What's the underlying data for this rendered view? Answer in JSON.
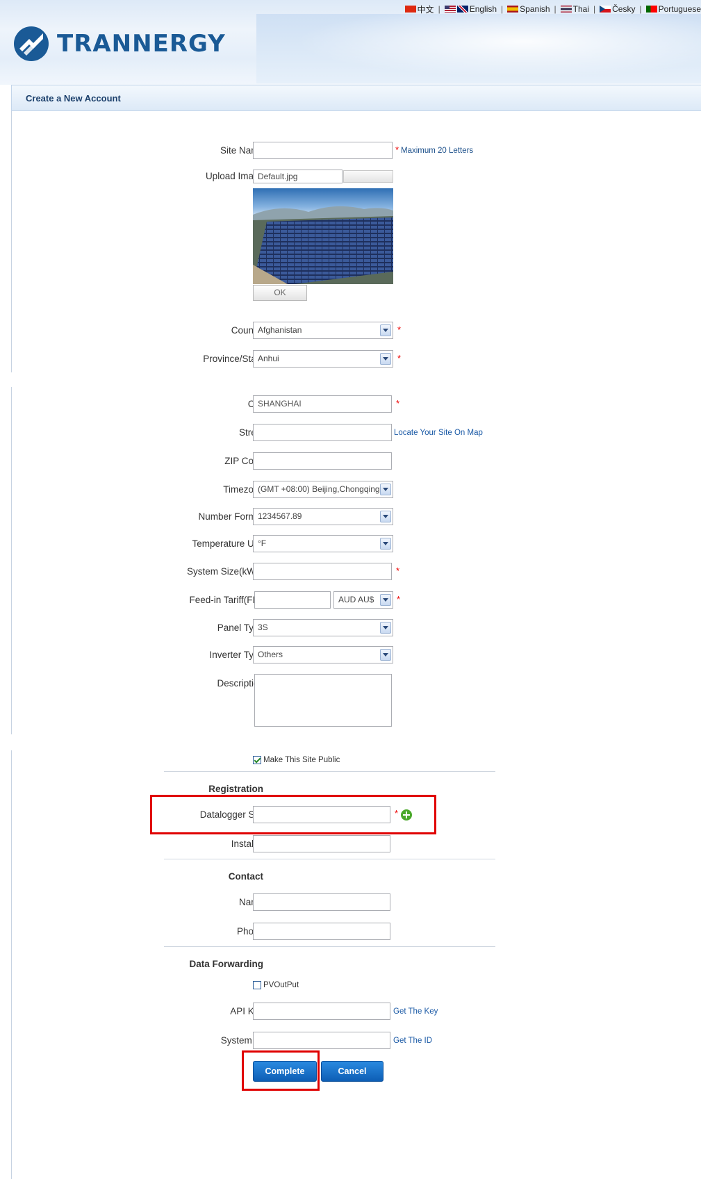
{
  "languages": [
    {
      "flag": "cn",
      "label": "中文"
    },
    {
      "flag": "us-uk",
      "label": "English"
    },
    {
      "flag": "es",
      "label": "Spanish"
    },
    {
      "flag": "th",
      "label": "Thai"
    },
    {
      "flag": "cz",
      "label": "Česky"
    },
    {
      "flag": "pt",
      "label": "Portuguese"
    }
  ],
  "brand": {
    "name": "TRANNERGY",
    "color": "#1a5a96"
  },
  "page": {
    "title": "Create a New Account"
  },
  "form": {
    "site_name": {
      "label": "Site Name",
      "value": "",
      "hint": "Maximum 20 Letters"
    },
    "upload_image": {
      "label": "Upload Image",
      "value": "Default.jpg",
      "ok_label": "OK"
    },
    "country": {
      "label": "Country",
      "value": "Afghanistan"
    },
    "province": {
      "label": "Province/State",
      "value": "Anhui"
    },
    "city": {
      "label": "City",
      "value": "SHANGHAI"
    },
    "street": {
      "label": "Street",
      "value": "",
      "link": "Locate Your Site On Map"
    },
    "zip": {
      "label": "ZIP Code",
      "value": ""
    },
    "timezone": {
      "label": "Timezone",
      "value": "(GMT +08:00) Beijing,Chongqing"
    },
    "number_format": {
      "label": "Number Format",
      "value": "1234567.89"
    },
    "temperature_unit": {
      "label": "Temperature Unit",
      "value": "°F"
    },
    "system_size": {
      "label": "System Size(kWp)",
      "value": ""
    },
    "fit": {
      "label": "Feed-in Tariff(FIT)",
      "value": "",
      "currency": "AUD AU$"
    },
    "panel_type": {
      "label": "Panel Type",
      "value": "3S"
    },
    "inverter_type": {
      "label": "Inverter Type",
      "value": "Others"
    },
    "description": {
      "label": "Description",
      "value": ""
    },
    "public": {
      "label": "Make This Site Public",
      "checked": true
    }
  },
  "registration": {
    "heading": "Registration",
    "datalogger": {
      "label": "Datalogger S/N",
      "value": ""
    },
    "installer": {
      "label": "Installer",
      "value": ""
    }
  },
  "contact": {
    "heading": "Contact",
    "name": {
      "label": "Name",
      "value": ""
    },
    "phone": {
      "label": "Phone",
      "value": ""
    }
  },
  "forwarding": {
    "heading": "Data Forwarding",
    "pvoutput": {
      "label": "PVOutPut",
      "checked": false
    },
    "api_key": {
      "label": "API Key",
      "value": "",
      "link": "Get The Key"
    },
    "system_id": {
      "label": "System ID",
      "value": "",
      "link": "Get The ID"
    }
  },
  "actions": {
    "complete": "Complete",
    "cancel": "Cancel"
  },
  "colors": {
    "accent": "#1b5aa6",
    "required": "#e00000",
    "highlight": "#e00000",
    "button": "#1565c0"
  }
}
